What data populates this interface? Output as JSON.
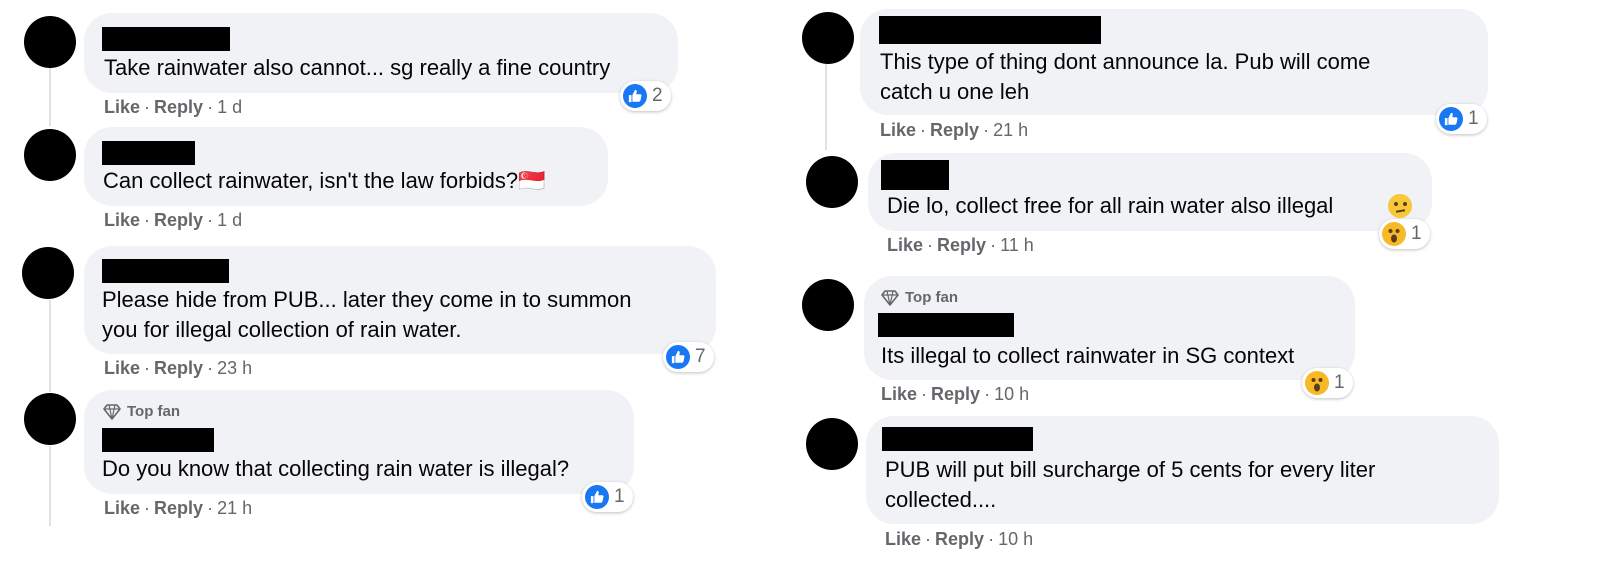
{
  "actions": {
    "like": "Like",
    "reply": "Reply",
    "sep": "·"
  },
  "comments": [
    {
      "text_lines": [
        "Take rainwater also cannot... sg really a fine country"
      ],
      "time": "1 d",
      "reaction": {
        "icon": "like-icon",
        "count": "2"
      }
    },
    {
      "text_lines": [
        "Can collect rainwater, isn't the law forbids?🇸🇬"
      ],
      "time": "1 d"
    },
    {
      "text_lines": [
        "Please hide from PUB... later they come in to summon",
        "you for illegal collection of rain water."
      ],
      "time": "23 h",
      "reaction": {
        "icon": "like-icon",
        "count": "7"
      }
    },
    {
      "badge": "Top fan",
      "text_lines": [
        "Do you know that collecting rain water is illegal?"
      ],
      "time": "21 h",
      "reaction": {
        "icon": "like-icon",
        "count": "1"
      }
    },
    {
      "text_lines": [
        "This type of thing dont announce la. Pub will come",
        "catch u one leh"
      ],
      "time": "21 h",
      "reaction": {
        "icon": "like-icon",
        "count": "1"
      }
    },
    {
      "text_lines": [
        "Die lo, collect free for all rain water also illegal"
      ],
      "emoji": "thinking-face-emoji",
      "time": "11 h",
      "reaction": {
        "icon": "wow-icon",
        "count": "1"
      }
    },
    {
      "badge": "Top fan",
      "text_lines": [
        "Its illegal to collect rainwater in SG context"
      ],
      "time": "10 h",
      "reaction": {
        "icon": "wow-icon",
        "count": "1"
      }
    },
    {
      "text_lines": [
        "PUB will put bill surcharge of 5 cents for every liter",
        "collected...."
      ],
      "time": "10 h"
    }
  ],
  "colors": {
    "like_blue": "#1877f2",
    "wow_yellow": "#f7b928",
    "bubble": "#f0f2f5",
    "meta_gray": "#65676b"
  }
}
